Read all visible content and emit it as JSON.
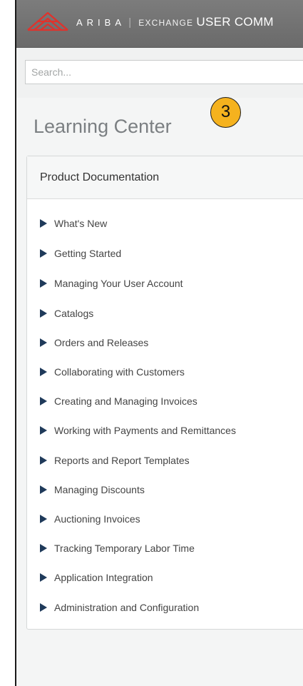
{
  "header": {
    "logo_icon": "ariba-logo-icon",
    "brand_name": "ARIBA",
    "brand_separator": "|",
    "brand_exchange": "EXCHANGE",
    "brand_community": "USER COMM",
    "background": "#6f6f6f"
  },
  "search": {
    "placeholder": "Search...",
    "value": ""
  },
  "page": {
    "title": "Learning Center"
  },
  "callout": {
    "number": "3",
    "color": "#f5b21e"
  },
  "panel": {
    "title": "Product Documentation",
    "items": [
      {
        "label": "What's New"
      },
      {
        "label": "Getting Started"
      },
      {
        "label": "Managing Your User Account"
      },
      {
        "label": "Catalogs"
      },
      {
        "label": "Orders and Releases"
      },
      {
        "label": "Collaborating with Customers"
      },
      {
        "label": "Creating and Managing Invoices"
      },
      {
        "label": "Working with Payments and Remittances"
      },
      {
        "label": "Reports and Report Templates"
      },
      {
        "label": "Managing Discounts"
      },
      {
        "label": "Auctioning Invoices"
      },
      {
        "label": "Tracking Temporary Labor Time"
      },
      {
        "label": "Application Integration"
      },
      {
        "label": "Administration and Configuration"
      }
    ],
    "item_icon": "triangle-right-icon"
  }
}
